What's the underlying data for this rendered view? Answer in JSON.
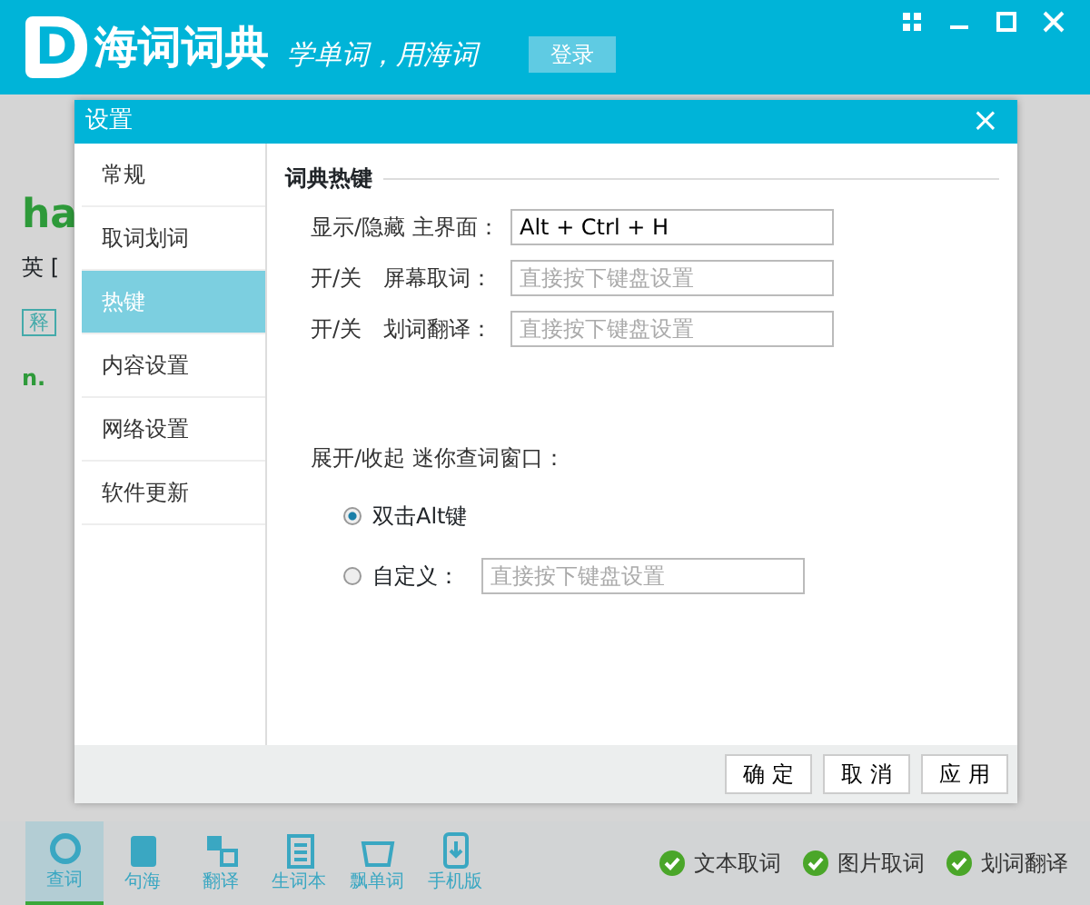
{
  "app": {
    "logo_letter": "D",
    "name": "海词词典",
    "slogan": "学单词，用海词",
    "login": "登录"
  },
  "background": {
    "word": "ha",
    "phonetic": "英 [",
    "tag": "释",
    "pos": "n."
  },
  "dialog": {
    "title": "设置",
    "close": "×",
    "sidebar": [
      {
        "label": "常规",
        "selected": false
      },
      {
        "label": "取词划词",
        "selected": false
      },
      {
        "label": "热键",
        "selected": true
      },
      {
        "label": "内容设置",
        "selected": false
      },
      {
        "label": "网络设置",
        "selected": false
      },
      {
        "label": "软件更新",
        "selected": false
      }
    ],
    "section": "词典热键",
    "hotkeys": [
      {
        "label": "显示/隐藏 主界面：",
        "value": "Alt + Ctrl + H"
      },
      {
        "label": "开/关　屏幕取词：",
        "placeholder": "直接按下键盘设置"
      },
      {
        "label": "开/关　划词翻译：",
        "placeholder": "直接按下键盘设置"
      }
    ],
    "mini_label": "展开/收起 迷你查词窗口：",
    "mini_options": [
      {
        "label": "双击Alt键",
        "selected": true
      },
      {
        "label": "自定义：",
        "selected": false,
        "placeholder": "直接按下键盘设置"
      }
    ],
    "buttons": [
      "确 定",
      "取 消",
      "应 用"
    ]
  },
  "toolbar": [
    {
      "label": "查词",
      "selected": true
    },
    {
      "label": "句海",
      "selected": false
    },
    {
      "label": "翻译",
      "selected": false
    },
    {
      "label": "生词本",
      "selected": false
    },
    {
      "label": "飘单词",
      "selected": false
    },
    {
      "label": "手机版",
      "selected": false
    }
  ],
  "toggles": [
    {
      "label": "文本取词",
      "checked": true
    },
    {
      "label": "图片取词",
      "checked": true
    },
    {
      "label": "划词翻译",
      "checked": true
    }
  ]
}
